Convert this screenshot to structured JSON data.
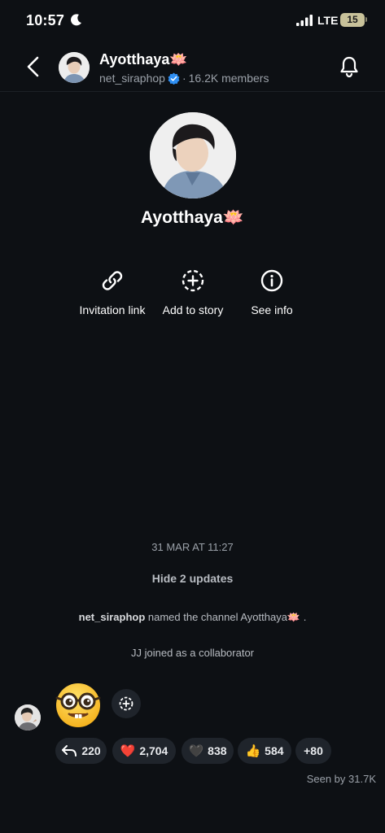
{
  "status_bar": {
    "time": "10:57",
    "network": "LTE",
    "battery": "15"
  },
  "header": {
    "channel_name": "Ayotthaya🪷",
    "owner": "net_siraphop",
    "members": "16.2K members",
    "separator": "·"
  },
  "profile": {
    "name": "Ayotthaya🪷"
  },
  "actions": [
    {
      "label": "Invitation link",
      "icon": "link-icon"
    },
    {
      "label": "Add to story",
      "icon": "add-story-icon"
    },
    {
      "label": "See info",
      "icon": "info-icon"
    }
  ],
  "feed": {
    "date": "31 MAR AT 11:27",
    "hide_updates": "Hide 2 updates",
    "event1_user": "net_siraphop",
    "event1_text": " named the channel Ayotthaya🪷 .",
    "event2_text": "JJ joined as a collaborator",
    "message_emoji": "nerd-face-emoji"
  },
  "reactions": [
    {
      "name": "reply",
      "count": "220"
    },
    {
      "name": "red-heart",
      "emoji": "❤️",
      "count": "2,704"
    },
    {
      "name": "black-heart",
      "emoji": "🖤",
      "count": "838"
    },
    {
      "name": "thumbs-up",
      "emoji": "👍",
      "count": "584"
    },
    {
      "name": "more",
      "count": "+80"
    }
  ],
  "seen_by": "Seen by 31.7K"
}
